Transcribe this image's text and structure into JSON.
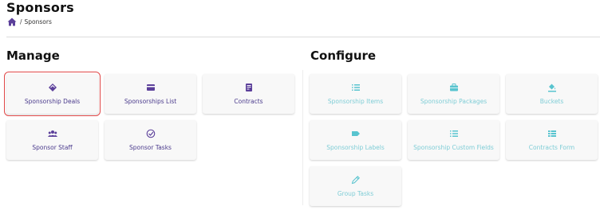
{
  "header": {
    "title": "Sponsors",
    "breadcrumb_separator": "/",
    "breadcrumb_current": "Sponsors"
  },
  "colors": {
    "manage_accent": "#5b3f9a",
    "configure_accent": "#58c4cf",
    "selected_outline": "#e04848"
  },
  "manage": {
    "title": "Manage",
    "items": [
      {
        "label": "Sponsorship Deals",
        "icon": "diamond-icon",
        "selected": true
      },
      {
        "label": "Sponsorships List",
        "icon": "card-icon"
      },
      {
        "label": "Contracts",
        "icon": "contract-icon"
      },
      {
        "label": "Sponsor Staff",
        "icon": "users-icon"
      },
      {
        "label": "Sponsor Tasks",
        "icon": "check-circle-icon"
      }
    ]
  },
  "configure": {
    "title": "Configure",
    "items": [
      {
        "label": "Sponsorship Items",
        "icon": "list-icon"
      },
      {
        "label": "Sponsorship Packages",
        "icon": "briefcase-icon"
      },
      {
        "label": "Buckets",
        "icon": "paint-bucket-icon"
      },
      {
        "label": "Sponsorship Labels",
        "icon": "tag-icon"
      },
      {
        "label": "Sponsorship Custom Fields",
        "icon": "list-icon"
      },
      {
        "label": "Contracts Form",
        "icon": "table-icon"
      },
      {
        "label": "Group Tasks",
        "icon": "pencil-icon"
      }
    ]
  }
}
